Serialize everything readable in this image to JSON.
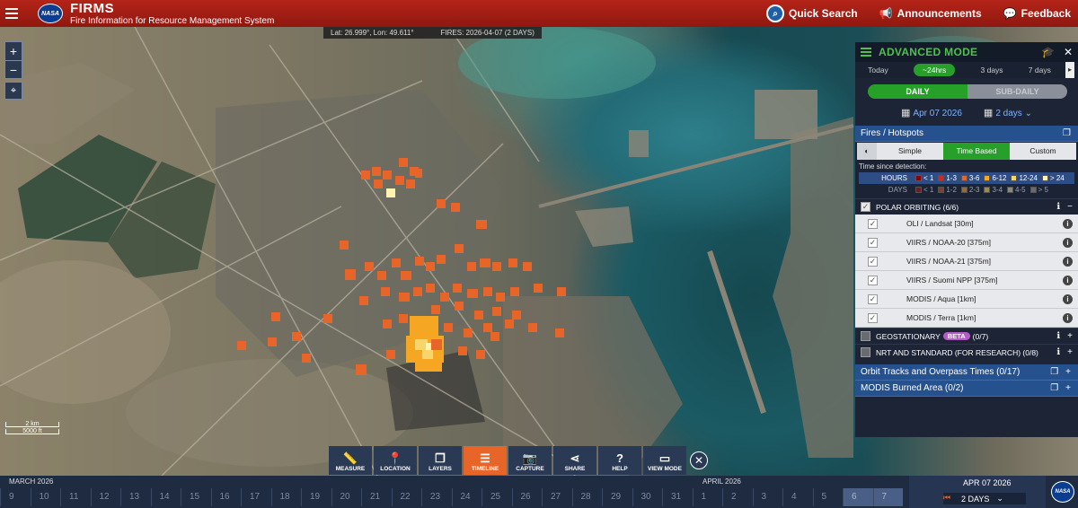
{
  "header": {
    "title": "FIRMS",
    "subtitle": "Fire Information for Resource Management System",
    "logo": "NASA",
    "links": [
      {
        "label": "Quick Search",
        "icon": "search-icon"
      },
      {
        "label": "Announcements",
        "icon": "megaphone-icon"
      },
      {
        "label": "Feedback",
        "icon": "chat-icon"
      }
    ]
  },
  "map": {
    "coords": "Lat: 26.999°, Lon: 49.611°",
    "fires": "FIRES: 2026-04-07 (2 DAYS)",
    "zoom_in": "+",
    "zoom_out": "−",
    "scale_km": "2 km",
    "scale_ft": "5000 ft"
  },
  "toolbar": {
    "tools": [
      {
        "label": "MEASURE",
        "icon": "ruler-icon",
        "glyph": "📏"
      },
      {
        "label": "LOCATION",
        "icon": "location-pin-icon",
        "glyph": "📍"
      },
      {
        "label": "LAYERS",
        "icon": "layers-icon",
        "glyph": "❐"
      },
      {
        "label": "TIMELINE",
        "icon": "timeline-icon",
        "glyph": "☰",
        "active": true
      },
      {
        "label": "CAPTURE",
        "icon": "camera-icon",
        "glyph": "📷"
      },
      {
        "label": "SHARE",
        "icon": "share-icon",
        "glyph": "⋖"
      },
      {
        "label": "HELP",
        "icon": "help-icon",
        "glyph": "?"
      },
      {
        "label": "VIEW MODE",
        "icon": "monitor-icon",
        "glyph": "▭"
      }
    ],
    "close": "✕"
  },
  "timeline": {
    "month1": "MARCH 2026",
    "month2": "APRIL 2026",
    "days": [
      "9",
      "10",
      "11",
      "12",
      "13",
      "14",
      "15",
      "16",
      "17",
      "18",
      "19",
      "20",
      "21",
      "22",
      "23",
      "24",
      "25",
      "26",
      "27",
      "28",
      "29",
      "30",
      "31",
      "1",
      "2",
      "3",
      "4",
      "5",
      "6",
      "7"
    ],
    "selected_days": [
      "6",
      "7"
    ],
    "date": "APR 07 2026",
    "range": "2 DAYS",
    "logo": "NASA"
  },
  "panel": {
    "title": "ADVANCED MODE",
    "range_tabs": [
      "Today",
      "~24hrs",
      "3 days",
      "7 days"
    ],
    "active_range": "~24hrs",
    "modes": {
      "daily": "DAILY",
      "subdaily": "SUB-DAILY"
    },
    "date": "Apr 07 2026",
    "days": "2 days",
    "fires_section": "Fires / Hotspots",
    "view_tabs": [
      "Simple",
      "Time Based",
      "Custom"
    ],
    "active_view": "Time Based",
    "legend": {
      "title": "Time since detection:",
      "hours_label": "HOURS",
      "hours": [
        {
          "label": "< 1",
          "color": "#8b0000"
        },
        {
          "label": "1-3",
          "color": "#e02020"
        },
        {
          "label": "3-6",
          "color": "#e8652a"
        },
        {
          "label": "6-12",
          "color": "#f5a623"
        },
        {
          "label": "12-24",
          "color": "#f8d56b"
        },
        {
          "label": "> 24",
          "color": "#fff3b0"
        }
      ],
      "days_label": "DAYS",
      "days": [
        {
          "label": "< 1",
          "color": "#6b2020"
        },
        {
          "label": "1-2",
          "color": "#8a3a2a"
        },
        {
          "label": "2-3",
          "color": "#9a6a2a"
        },
        {
          "label": "3-4",
          "color": "#9a8a5a"
        },
        {
          "label": "4-5",
          "color": "#8a8a7a"
        },
        {
          "label": "> 5",
          "color": "#6a6a6a"
        }
      ]
    },
    "polar": {
      "label": "POLAR ORBITING (6/6)"
    },
    "layers": [
      "OLI / Landsat [30m]",
      "VIIRS / NOAA-20 [375m]",
      "VIIRS / NOAA-21 [375m]",
      "VIIRS / Suomi NPP [375m]",
      "MODIS / Aqua [1km]",
      "MODIS / Terra [1km]"
    ],
    "geo": {
      "label": "GEOSTATIONARY",
      "beta": "BETA",
      "count": "(0/7)"
    },
    "nrt": {
      "label": "NRT AND STANDARD (FOR RESEARCH) (0/8)"
    },
    "orbit": "Orbit Tracks and Overpass Times (0/17)",
    "burned": "MODIS Burned Area (0/2)"
  },
  "colors": {
    "header": "#b52418",
    "accent_green": "#27a02a",
    "fire_3_6": "#e8652a",
    "fire_6_12": "#f5a623",
    "fire_12_24": "#f8d56b",
    "fire_gt24": "#fff3b0"
  }
}
